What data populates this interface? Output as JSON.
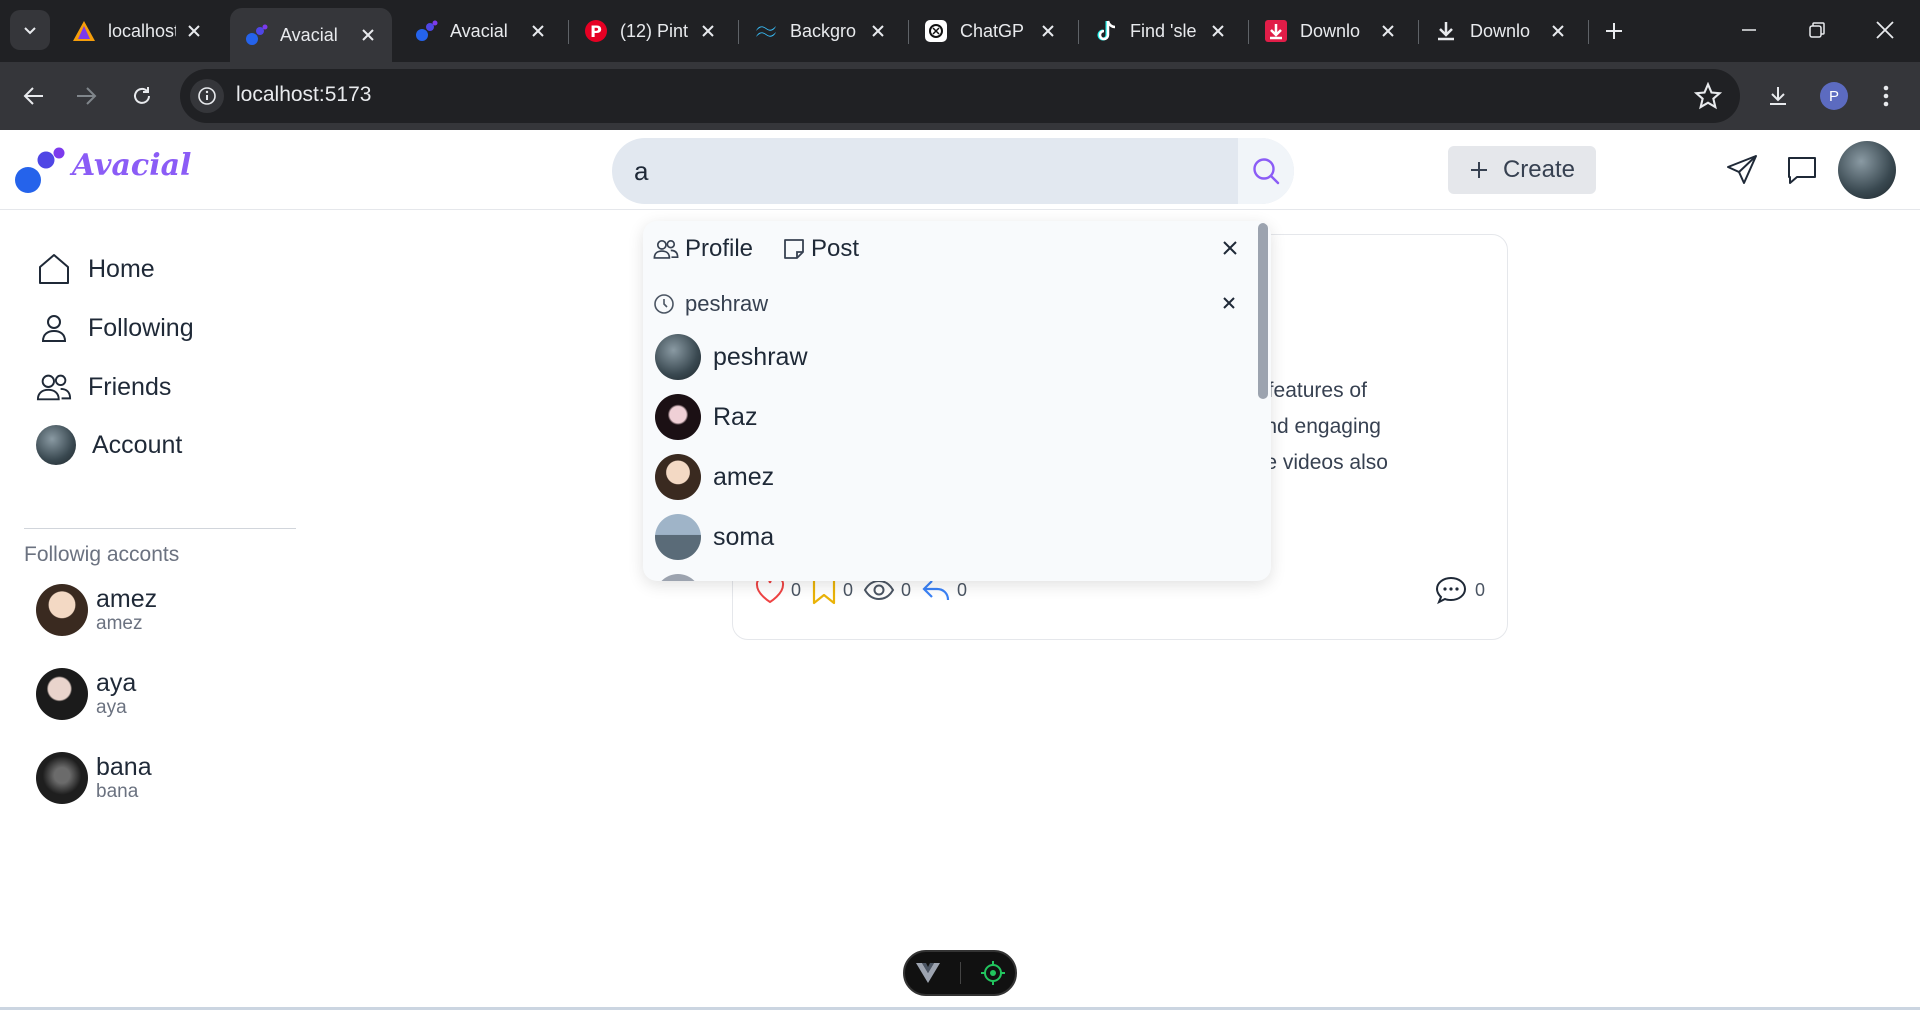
{
  "browser": {
    "tabs": [
      {
        "title": "localhost",
        "favicon": "vite-icon",
        "active": false
      },
      {
        "title": "Avacial",
        "favicon": "avacial-logo-icon",
        "active": true
      },
      {
        "title": "Avacial",
        "favicon": "avacial-logo-icon",
        "active": false
      },
      {
        "title": "(12) Pint",
        "favicon": "pinterest-icon",
        "active": false
      },
      {
        "title": "Backgro",
        "favicon": "tailwind-icon",
        "active": false
      },
      {
        "title": "ChatGP",
        "favicon": "chatgpt-icon",
        "active": false
      },
      {
        "title": "Find 'sle",
        "favicon": "tiktok-icon",
        "active": false
      },
      {
        "title": "Downlo",
        "favicon": "download-red-icon",
        "active": false
      },
      {
        "title": "Downlo",
        "favicon": "download-icon",
        "active": false
      }
    ],
    "url": "localhost:5173",
    "profile_initial": "P"
  },
  "app": {
    "brand": "Avacial",
    "search_value": "a",
    "create_label": "Create"
  },
  "sidebar": {
    "items": [
      {
        "label": "Home",
        "icon": "home-icon"
      },
      {
        "label": "Following",
        "icon": "user-icon"
      },
      {
        "label": "Friends",
        "icon": "users-icon"
      },
      {
        "label": "Account",
        "icon": "avatar"
      }
    ],
    "following_heading": "Followig acconts",
    "following": [
      {
        "name": "amez",
        "handle": "amez"
      },
      {
        "name": "aya",
        "handle": "aya"
      },
      {
        "name": "bana",
        "handle": "bana"
      }
    ]
  },
  "post": {
    "text_lines": [
      "ome features of",
      "tile and engaging",
      "eative videos also"
    ],
    "likes": "0",
    "saves": "0",
    "views": "0",
    "shares": "0",
    "comments": "0"
  },
  "search_dropdown": {
    "tabs": [
      {
        "label": "Profile",
        "icon": "users-icon"
      },
      {
        "label": "Post",
        "icon": "note-icon"
      }
    ],
    "recent": "peshraw",
    "results": [
      {
        "name": "peshraw"
      },
      {
        "name": "Raz"
      },
      {
        "name": "amez"
      },
      {
        "name": "soma"
      }
    ]
  },
  "colors": {
    "brand": "#8b5cf6",
    "logo_blue": "#2563eb",
    "like_red": "#ef4444",
    "save_yellow": "#eab308",
    "share_blue": "#3b82f6",
    "dev_green": "#22c55e"
  }
}
